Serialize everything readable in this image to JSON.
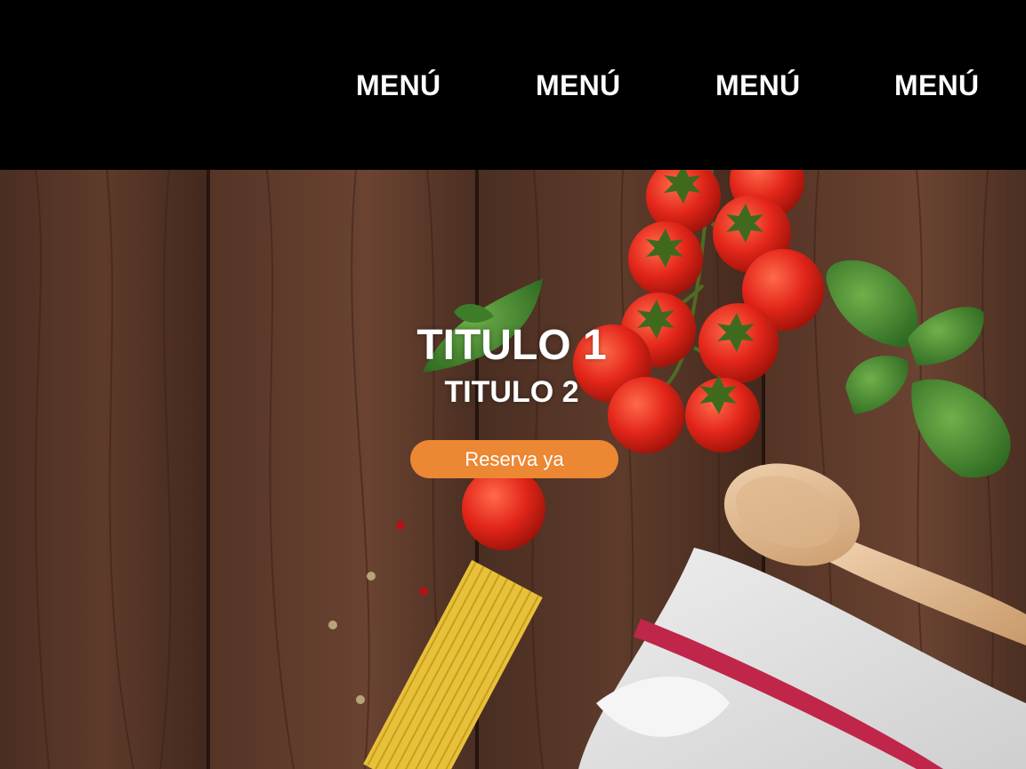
{
  "nav": {
    "items": [
      {
        "label": "MENÚ"
      },
      {
        "label": "MENÚ"
      },
      {
        "label": "MENÚ"
      },
      {
        "label": "MENÚ"
      }
    ]
  },
  "hero": {
    "title1": "TITULO 1",
    "title2": "TITULO 2",
    "cta_label": "Reserva ya",
    "cta_color": "#ec8733",
    "background": "food-on-wooden-table-image"
  }
}
